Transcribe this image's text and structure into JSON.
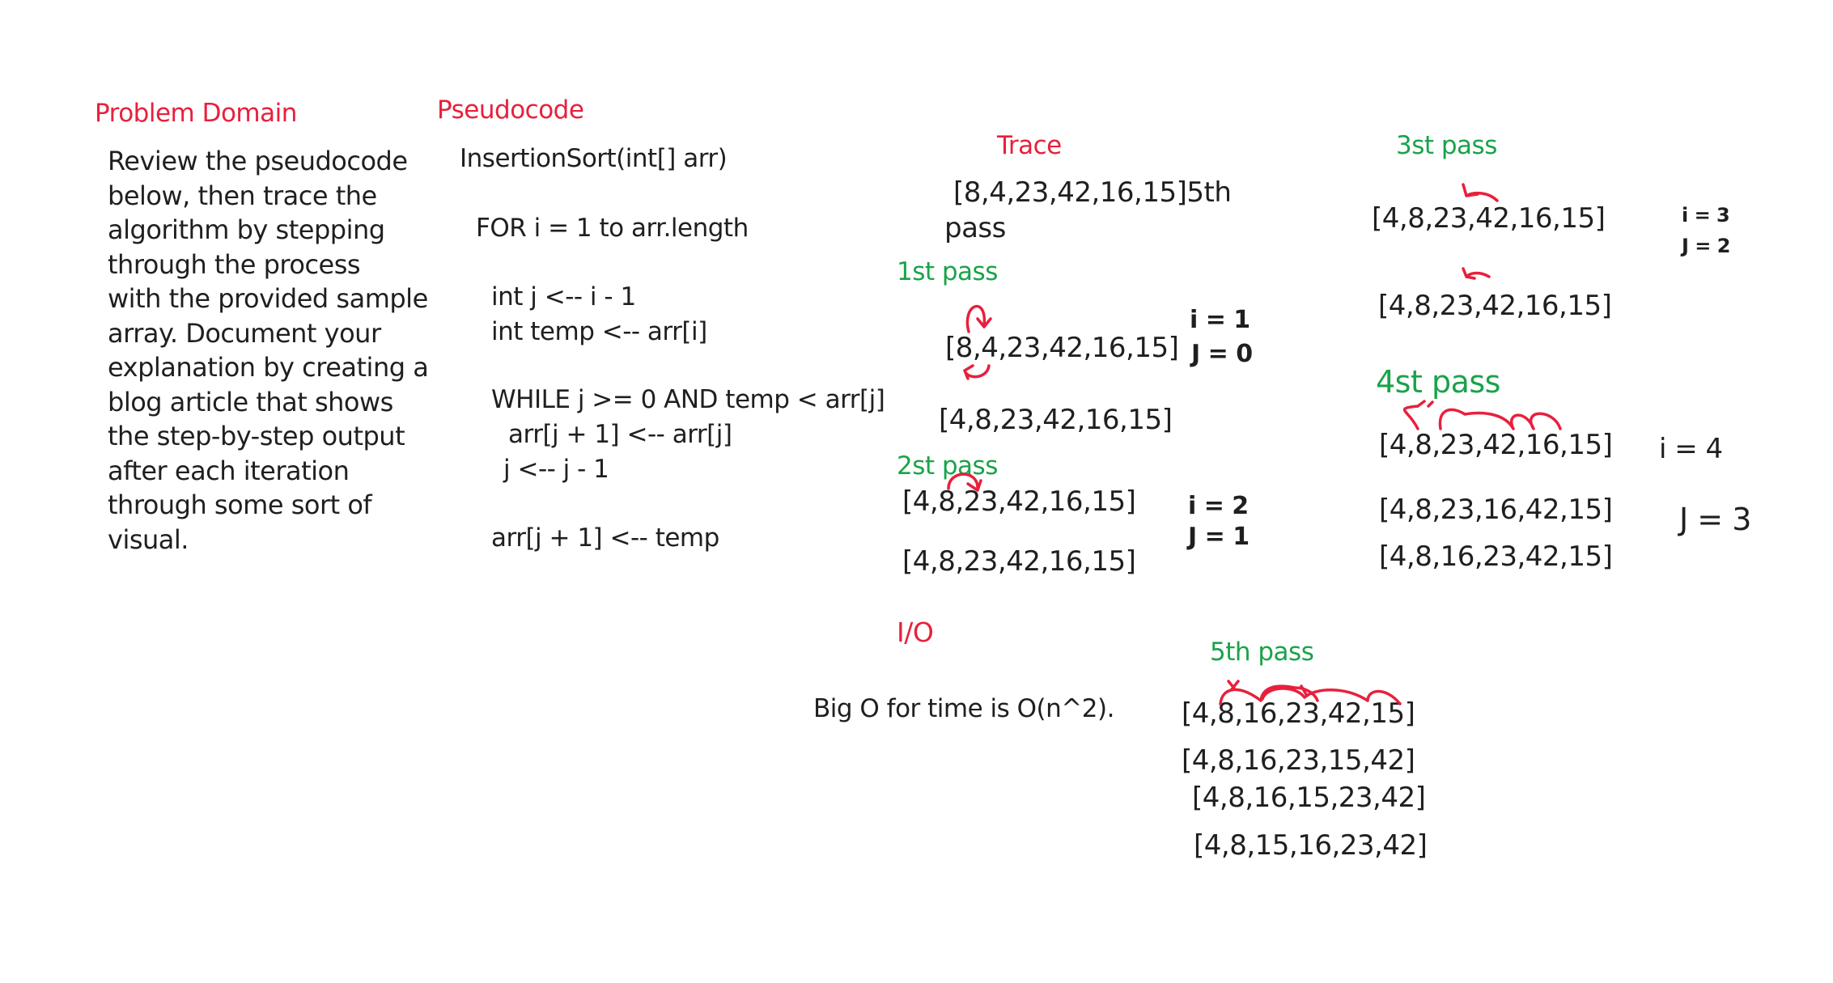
{
  "problem": {
    "heading": "Problem Domain",
    "lines": [
      "Review the pseudocode",
      "below, then trace the",
      "algorithm by stepping",
      "through the process",
      "with the provided sample",
      "array. Document your",
      "explanation by creating a",
      "blog article that shows",
      "the step-by-step output",
      "after each iteration",
      "through some sort of",
      "visual."
    ]
  },
  "pseudocode": {
    "heading": "Pseudocode",
    "lines": [
      "InsertionSort(int[] arr)",
      "FOR i = 1 to arr.length",
      "int j <-- i - 1",
      "int temp <-- arr[i]",
      "WHILE j >= 0 AND temp < arr[j]",
      "arr[j + 1] <-- arr[j]",
      "j <-- j - 1",
      "arr[j + 1] <-- temp"
    ]
  },
  "trace": {
    "heading": "Trace",
    "start_array": "[8,4,23,42,16,15]5th",
    "start_note": "pass"
  },
  "pass1": {
    "label": "1st pass",
    "rows": [
      "[8,4,23,42,16,15]",
      "[4,8,23,42,16,15]"
    ],
    "i_note": "i = 1",
    "j_note": "J = 0"
  },
  "pass2": {
    "label": "2st pass",
    "rows": [
      "[4,8,23,42,16,15]",
      "[4,8,23,42,16,15]"
    ],
    "i_note": "i = 2",
    "j_note": "J = 1"
  },
  "pass3": {
    "label": "3st pass",
    "rows": [
      "[4,8,23,42,16,15]",
      "[4,8,23,42,16,15]"
    ],
    "i_note": "i = 3",
    "j_note": "J = 2"
  },
  "pass4": {
    "label": "4st pass",
    "rows": [
      "[4,8,23,42,16,15]",
      "[4,8,23,16,42,15]",
      "[4,8,16,23,42,15]"
    ],
    "i_note": "i = 4",
    "j_note": "J = 3"
  },
  "io": {
    "heading": "I/O",
    "text": "Big O for time is O(n^2)."
  },
  "pass5": {
    "label": "5th pass",
    "rows": [
      "[4,8,16,23,42,15]",
      "[4,8,16,23,15,42]",
      "[4,8,16,15,23,42]",
      "[4,8,15,16,23,42]"
    ]
  },
  "colors": {
    "heading_red": "#e8203c",
    "pass_green": "#1aa34a",
    "ink": "#1f1f1f"
  },
  "icons": [
    "swap-arrow-icon"
  ]
}
